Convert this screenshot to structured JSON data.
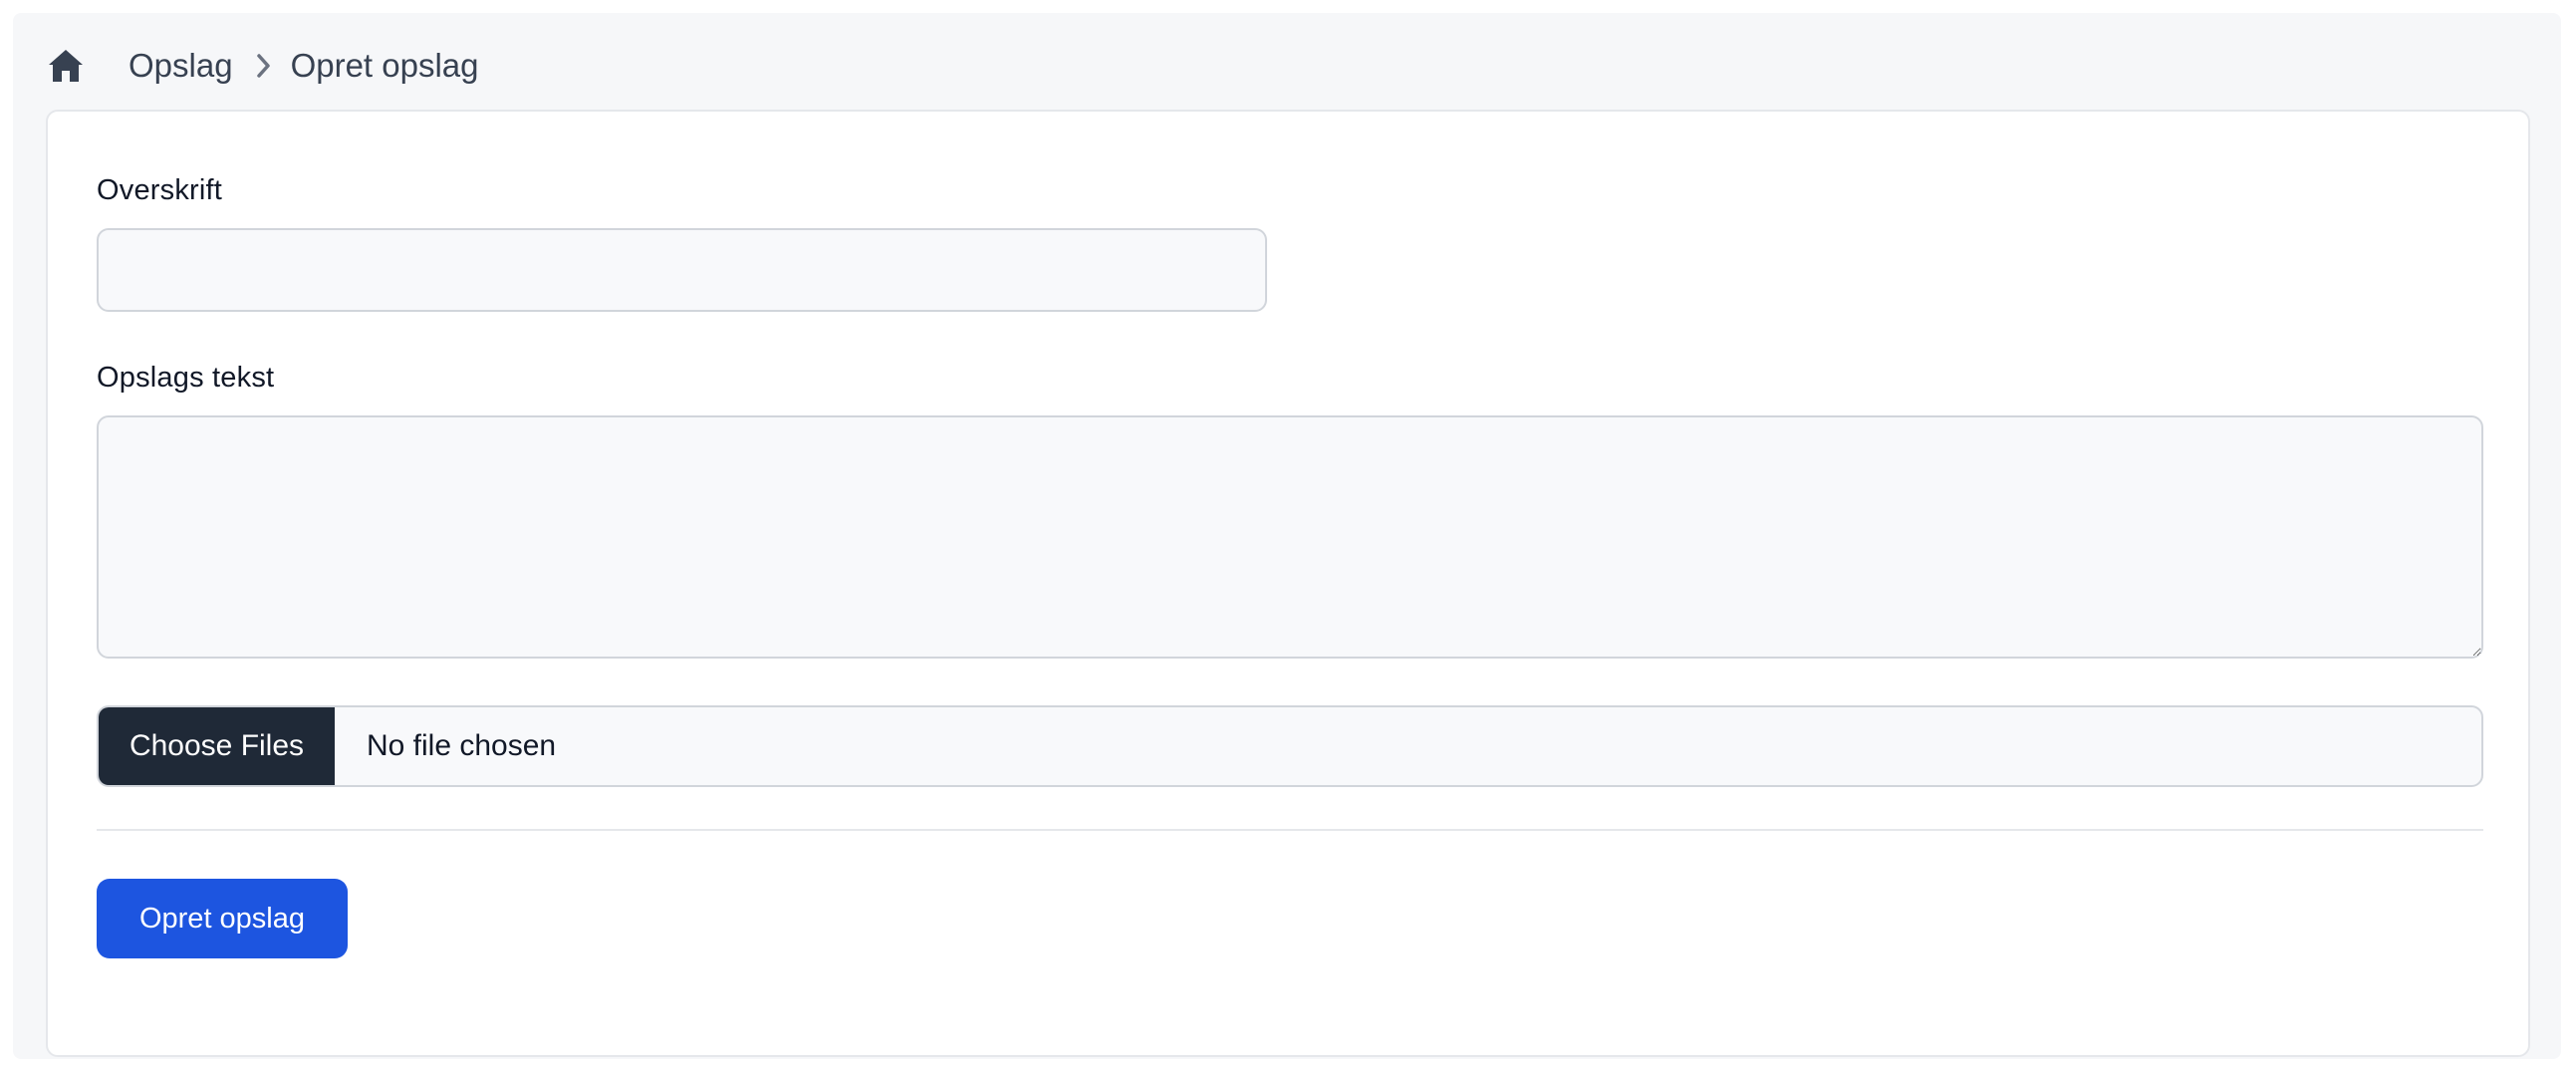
{
  "breadcrumb": {
    "home_icon": "home-icon",
    "items": [
      {
        "label": "Opslag"
      },
      {
        "label": "Opret opslag"
      }
    ],
    "separator_icon": "chevron-right-icon"
  },
  "form": {
    "title_field": {
      "label": "Overskrift",
      "value": "",
      "placeholder": ""
    },
    "text_field": {
      "label": "Opslags tekst",
      "value": "",
      "placeholder": ""
    },
    "file_input": {
      "button_label": "Choose Files",
      "status": "No file chosen"
    },
    "submit_label": "Opret opslag"
  },
  "colors": {
    "page_background": "#f6f7f9",
    "primary": "#1d55e0",
    "file_button": "#1f2937",
    "text": "#111827"
  }
}
